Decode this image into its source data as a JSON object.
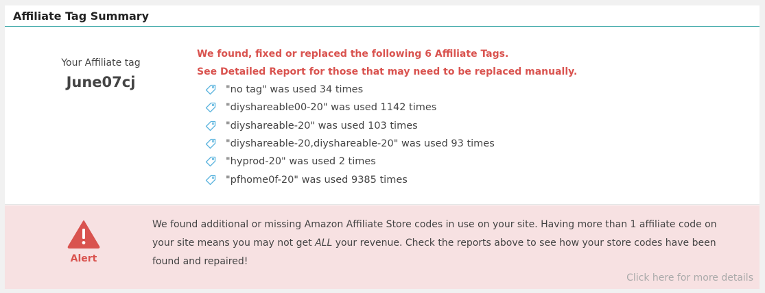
{
  "panel": {
    "title": "Affiliate Tag Summary"
  },
  "summary": {
    "tag_label": "Your Affiliate tag",
    "tag_value": "June07cj",
    "found_line1": "We found, fixed or replaced the following 6 Affiliate Tags.",
    "found_line2": "See Detailed Report for those that may need to be replaced manually.",
    "items": [
      {
        "text": "\"no tag\" was used 34 times"
      },
      {
        "text": "\"diyshareable00-20\" was used 1142 times"
      },
      {
        "text": "\"diyshareable-20\" was used 103 times"
      },
      {
        "text": "\"diyshareable-20,diyshareable-20\" was used 93 times"
      },
      {
        "text": "\"hyprod-20\" was used 2 times"
      },
      {
        "text": "\"pfhome0f-20\" was used 9385 times"
      }
    ]
  },
  "alert": {
    "label": "Alert",
    "text_before": "We found additional or missing Amazon Affiliate Store codes in use on your site. Having more than 1 affiliate code on your site means you may not get ",
    "text_emph": "ALL",
    "text_after": " your revenue. Check the reports above to see how your store codes have been found and repaired!",
    "details_link": "Click here for more details",
    "icon": "warning-triangle-icon",
    "color": "#d9534f"
  },
  "colors": {
    "accent": "#3aa6a6",
    "alert_bg": "#f7e1e2",
    "tag_icon": "#5bb4de"
  }
}
